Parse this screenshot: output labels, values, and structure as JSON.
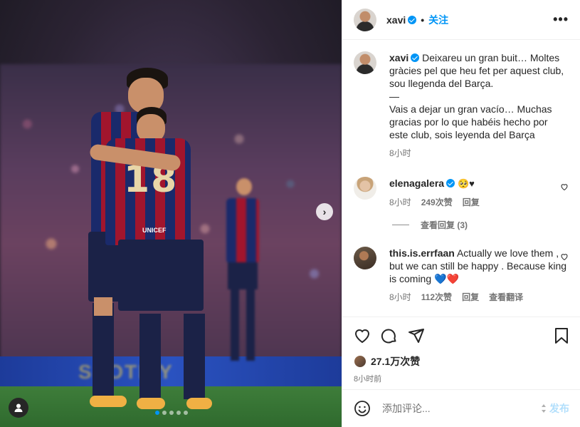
{
  "post": {
    "author": "xavi",
    "follow_label": "关注",
    "dot": "•",
    "more_label": "•••"
  },
  "media": {
    "jersey_number": "18",
    "sponsor_text": "UNICEF",
    "ad_board_text": "SPOTIFY",
    "carousel_next": "›"
  },
  "caption": {
    "user": "xavi",
    "text": "Deixareu un gran buit… Moltes gràcies pel que heu fet per aquest club, sou llegenda del Barça.\n—\nVais a dejar un gran vacío… Muchas gracias por lo que habéis hecho por este club, sois leyenda del Barça",
    "time": "8小时"
  },
  "comments": [
    {
      "user": "elenagalera",
      "text": "🥺♥",
      "time": "8小时",
      "likes": "249次赞",
      "reply": "回复",
      "view_replies": "查看回复 (3)"
    },
    {
      "user": "this.is.errfaan",
      "text": "Actually we love them , but we can still be happy . Because king is coming 💙❤️",
      "time": "8小时",
      "likes": "112次赞",
      "reply": "回复",
      "translate": "查看翻译"
    }
  ],
  "footer": {
    "likes_count": "27.1万次赞",
    "posted_ago": "8小时前",
    "comment_placeholder": "添加评论...",
    "post_label": "发布"
  },
  "colors": {
    "accent": "#0095f6",
    "text": "#262626",
    "muted": "#737373",
    "post_disabled": "#b2dffc"
  }
}
